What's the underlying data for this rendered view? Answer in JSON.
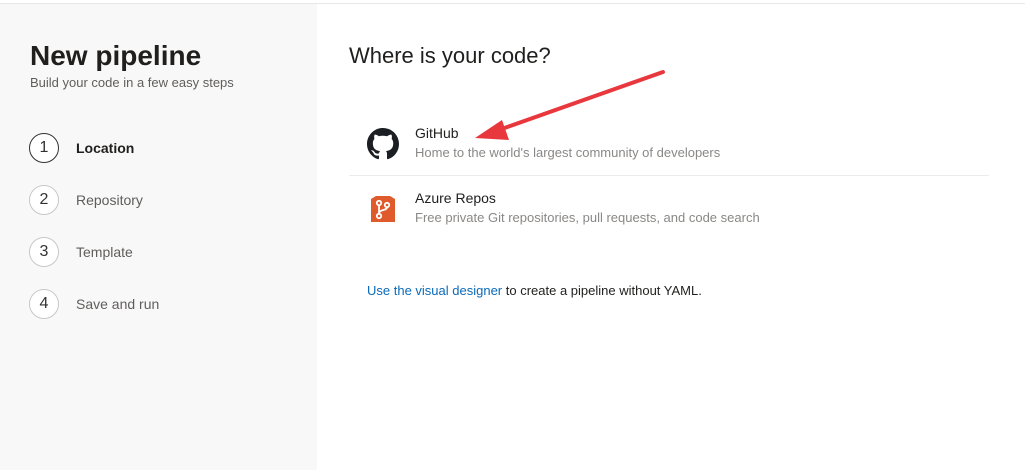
{
  "sidebar": {
    "title": "New pipeline",
    "subtitle": "Build your code in a few easy steps",
    "steps": [
      {
        "number": "1",
        "label": "Location",
        "active": true
      },
      {
        "number": "2",
        "label": "Repository",
        "active": false
      },
      {
        "number": "3",
        "label": "Template",
        "active": false
      },
      {
        "number": "4",
        "label": "Save and run",
        "active": false
      }
    ]
  },
  "main": {
    "heading": "Where is your code?",
    "sources": [
      {
        "name": "GitHub",
        "description": "Home to the world's largest community of developers",
        "icon": "github-icon"
      },
      {
        "name": "Azure Repos",
        "description": "Free private Git repositories, pull requests, and code search",
        "icon": "azure-repos-icon"
      }
    ],
    "designer_link": "Use the visual designer",
    "designer_suffix": " to create a pipeline without YAML."
  },
  "colors": {
    "sidebar_bg": "#f8f8f8",
    "link": "#0b6ab9",
    "azure_repos": "#e05b2b",
    "annotation_arrow": "#e8383d"
  }
}
